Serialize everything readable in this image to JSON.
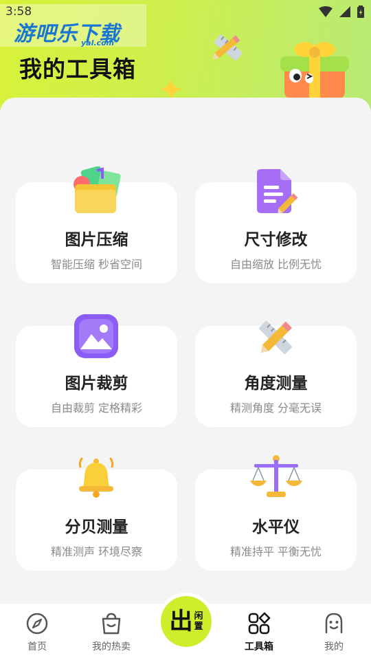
{
  "status_bar": {
    "time": "3:58"
  },
  "watermark": {
    "text": "游吧乐下载",
    "sub": "yal.com"
  },
  "header": {
    "title": "我的工具箱"
  },
  "tools": [
    {
      "title": "图片压缩",
      "subtitle": "智能压缩 秒省空间",
      "icon": "folder-images-icon"
    },
    {
      "title": "尺寸修改",
      "subtitle": "自由缩放 比例无忧",
      "icon": "document-edit-icon"
    },
    {
      "title": "图片裁剪",
      "subtitle": "自由裁剪 定格精彩",
      "icon": "image-icon"
    },
    {
      "title": "角度测量",
      "subtitle": "精测角度 分毫无误",
      "icon": "ruler-pencil-icon"
    },
    {
      "title": "分贝测量",
      "subtitle": "精准测声 环境尽察",
      "icon": "bell-icon"
    },
    {
      "title": "水平仪",
      "subtitle": "精准持平 平衡无忧",
      "icon": "balance-scale-icon"
    }
  ],
  "nav": {
    "items": [
      {
        "label": "首页",
        "icon": "compass-icon"
      },
      {
        "label": "我的热卖",
        "icon": "shopping-bag-icon"
      },
      {
        "label": "工具箱",
        "icon": "grid-icon",
        "active": true
      },
      {
        "label": "我的",
        "icon": "face-icon"
      }
    ],
    "center": {
      "main": "出",
      "small_top": "闲",
      "small_bottom": "置"
    }
  },
  "colors": {
    "accent": "#cdee2a",
    "purple": "#8b5cf6",
    "yellow": "#f5c536"
  }
}
